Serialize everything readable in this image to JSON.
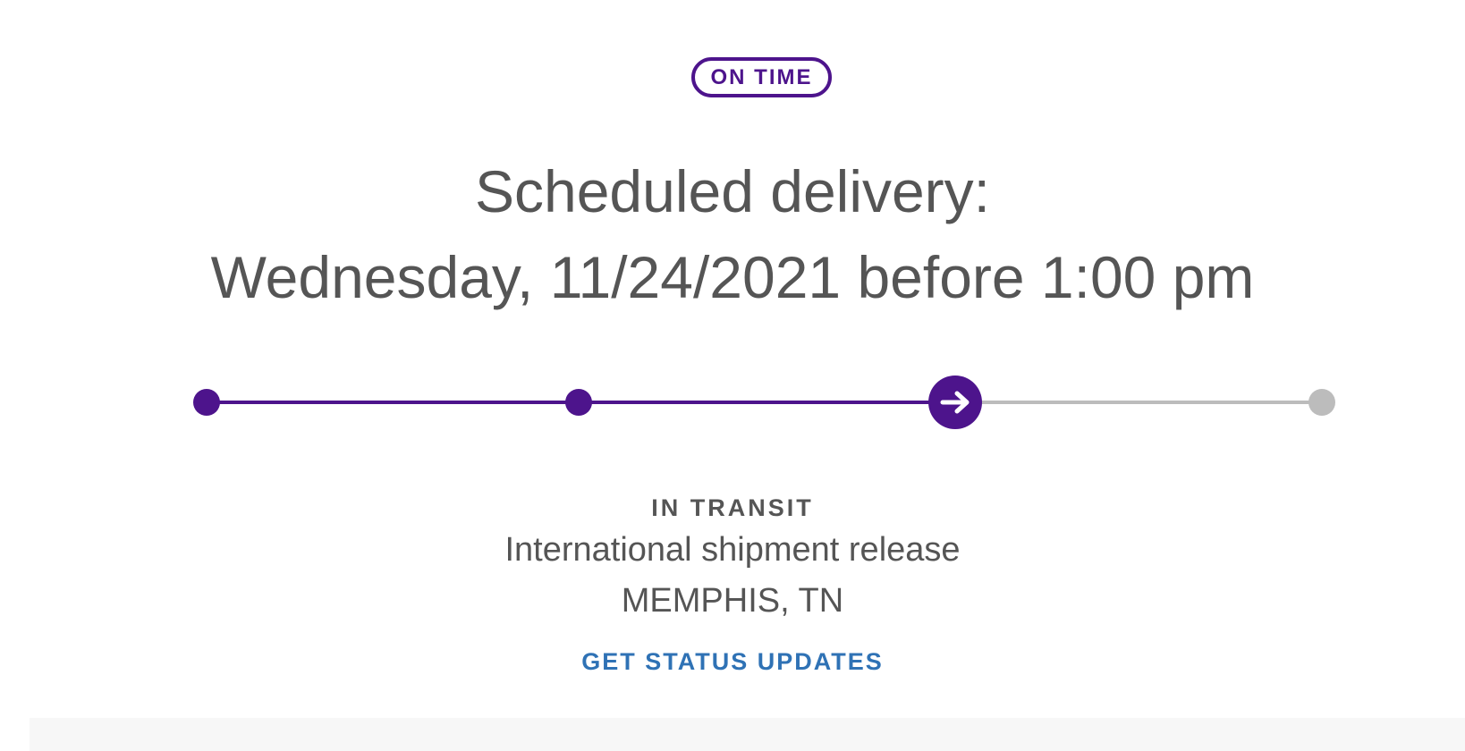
{
  "status_badge": "ON TIME",
  "delivery": {
    "line1": "Scheduled delivery:",
    "line2": "Wednesday, 11/24/2021 before 1:00 pm"
  },
  "progress": {
    "steps_total": 4,
    "current_step": 3,
    "current_icon": "arrow-right-icon",
    "colors": {
      "complete": "#4d148c",
      "pending": "#bcbcbc"
    }
  },
  "current_status": {
    "label": "IN TRANSIT",
    "description": "International shipment release",
    "location": "MEMPHIS, TN"
  },
  "actions": {
    "status_updates_label": "GET STATUS UPDATES"
  },
  "colors": {
    "brand_purple": "#4d148c",
    "text_gray": "#555555",
    "link_blue": "#2f72b5"
  }
}
